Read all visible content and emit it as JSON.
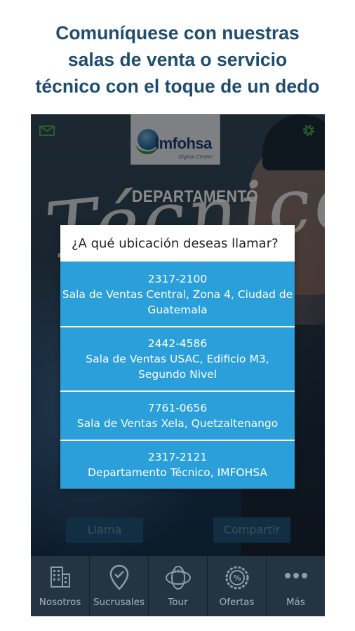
{
  "headline": {
    "line1": "Comuníquese con nuestras",
    "line2": "salas de venta o servicio",
    "line3": "técnico con el toque de un dedo"
  },
  "app": {
    "logo_text": "Imfohsa",
    "logo_sub": "Digital Center",
    "background_heading": "DEPARTAMENTO",
    "background_script": "Técnico"
  },
  "dialog": {
    "title": "¿A qué ubicación deseas llamar?",
    "options": [
      {
        "phone": "2317-2100",
        "line1": "Sala de Ventas Central, Zona 4, Ciudad de",
        "line2": "Guatemala"
      },
      {
        "phone": "2442-4586",
        "line1": "Sala de Ventas USAC, Edificio M3,",
        "line2": "Segundo Nivel"
      },
      {
        "phone": "7761-0656",
        "line1": "Sala de Ventas Xela, Quetzaltenango"
      },
      {
        "phone": "2317-2121",
        "line1": "Departamento Técnico, IMFOHSA"
      }
    ]
  },
  "buttons": {
    "call": "Llama",
    "share": "Compartir"
  },
  "tabs": [
    {
      "label": "Nosotros",
      "icon": "building-icon"
    },
    {
      "label": "Sucrusales",
      "icon": "map-pin-icon"
    },
    {
      "label": "Tour",
      "icon": "360-tour-icon"
    },
    {
      "label": "Ofertas",
      "icon": "percent-badge-icon"
    },
    {
      "label": "Más",
      "icon": "more-dots-icon"
    }
  ],
  "colors": {
    "headline": "#1e4d6e",
    "option_bg": "#2b9fd9",
    "tabbar_bg": "#243442",
    "icon_green": "#4caf50"
  }
}
